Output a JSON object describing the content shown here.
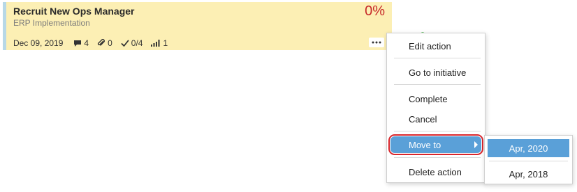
{
  "card": {
    "title": "Recruit New Ops Manager",
    "subtitle": "ERP Implementation",
    "progress": "0%",
    "date": "Dec 09, 2019",
    "comments": "4",
    "attachments": "0",
    "checklist": "0/4",
    "priority": "1",
    "icons": [
      "comment-icon",
      "paperclip-icon",
      "checkmark-icon",
      "signal-bars-icon",
      "ellipsis-icon"
    ]
  },
  "menu": {
    "edit_action": "Edit action",
    "go_to_initiative": "Go to initiative",
    "complete": "Complete",
    "cancel": "Cancel",
    "move_to": "Move to",
    "delete_action": "Delete action"
  },
  "submenu": {
    "items": [
      "Apr, 2020",
      "Apr, 2018"
    ]
  },
  "colors": {
    "card_background": "#fcefb4",
    "card_accent": "#b7d8e7",
    "progress_red": "#c62828",
    "highlight_blue": "#5aa0d8",
    "highlight_outline": "#d9262c"
  }
}
